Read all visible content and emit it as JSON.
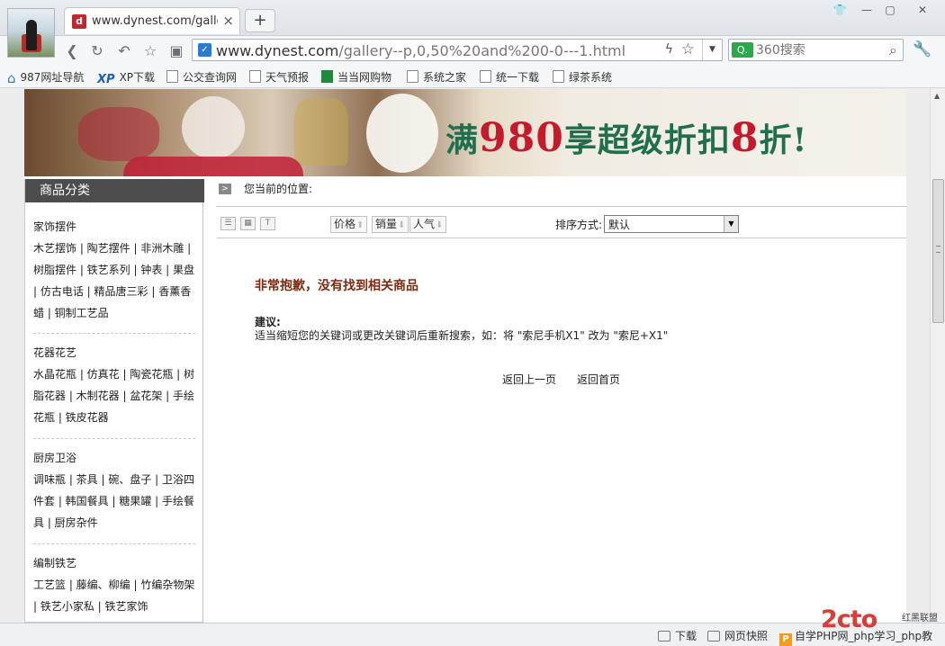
{
  "browser": {
    "tab_title": "www.dynest.com/gallery-",
    "tab_close": "×",
    "new_tab": "+",
    "url_domain": "www.dynest.com",
    "url_path": "/gallery--p,0,50%20and%200-0---1.html",
    "search_placeholder": "360搜索",
    "window_buttons": [
      "👕",
      "—",
      "▢",
      "✕"
    ]
  },
  "bookmarks": [
    {
      "label": "987网址导航",
      "icon": "home-icon"
    },
    {
      "label": "XP下载",
      "icon": "xp-icon"
    },
    {
      "label": "公交查询网",
      "icon": "doc-icon"
    },
    {
      "label": "天气预报",
      "icon": "doc-icon"
    },
    {
      "label": "当当网购物",
      "icon": "dangdang-icon"
    },
    {
      "label": "系统之家",
      "icon": "doc-icon"
    },
    {
      "label": "统一下载",
      "icon": "doc-icon"
    },
    {
      "label": "绿茶系统",
      "icon": "doc-icon"
    }
  ],
  "banner": {
    "slogan_pre": "满",
    "slogan_num": "980",
    "slogan_mid": "享超级折扣",
    "slogan_num2": "8",
    "slogan_post": "折!"
  },
  "sidebar": {
    "title": "商品分类",
    "categories": [
      {
        "title": "家饰摆件",
        "links": "木艺摆饰 | 陶艺摆件 | 非洲木雕 | 树脂摆件 | 铁艺系列 | 钟表 | 果盘 | 仿古电话 | 精品唐三彩 | 香薰香蜡 | 铜制工艺品"
      },
      {
        "title": "花器花艺",
        "links": "水晶花瓶 | 仿真花 | 陶瓷花瓶 | 树脂花器 | 木制花器 | 盆花架 | 手绘花瓶 | 铁皮花器"
      },
      {
        "title": "厨房卫浴",
        "links": "调味瓶 | 茶具 | 碗、盘子 | 卫浴四件套 | 韩国餐具 | 糖果罐 | 手绘餐具 | 厨房杂件"
      },
      {
        "title": "编制铁艺",
        "links": "工艺篮 | 藤编、柳编 | 竹编杂物架 | 铁艺小家私 | 铁艺家饰"
      }
    ]
  },
  "main": {
    "breadcrumb": "您当前的位置:",
    "sort_buttons": [
      "价格",
      "销量",
      "人气"
    ],
    "sort_label": "排序方式:",
    "sort_value": "默认",
    "not_found": "非常抱歉，没有找到相关商品",
    "suggest_label": "建议:",
    "suggest_text": "适当缩短您的关键词或更改关键词后重新搜索，如：将 \"索尼手机X1\" 改为 \"索尼+X1\"",
    "back_prev": "返回上一页",
    "back_home": "返回首页"
  },
  "statusbar": {
    "download": "下载",
    "snapshot": "网页快照",
    "php": "自学PHP网_php学习_php教"
  },
  "watermark": {
    "brand": "2cto",
    "small": "红黑联盟"
  }
}
